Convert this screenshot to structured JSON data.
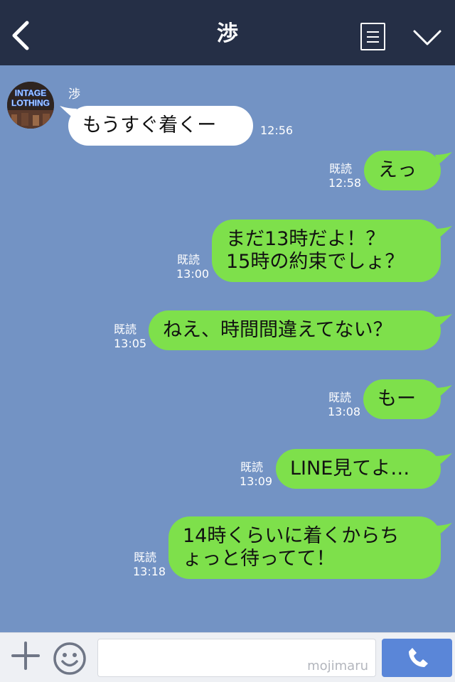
{
  "header": {
    "title": "渉",
    "icons": {
      "back": "chevron-left-icon",
      "menu": "menu-icon",
      "collapse": "chevron-down-icon"
    }
  },
  "chat": {
    "sender_name": "渉",
    "avatar_text": [
      "INTAGE",
      "LOTHING"
    ],
    "messages": [
      {
        "direction": "in",
        "lines": [
          "もうすぐ着くー"
        ],
        "time": "12:56"
      },
      {
        "direction": "out",
        "lines": [
          "えっ"
        ],
        "read": "既読",
        "time": "12:58"
      },
      {
        "direction": "out",
        "lines": [
          "まだ13時だよ！？",
          "15時の約束でしょ？"
        ],
        "read": "既読",
        "time": "13:00"
      },
      {
        "direction": "out",
        "lines": [
          "ねえ、時間間違えてない？"
        ],
        "read": "既読",
        "time": "13:05"
      },
      {
        "direction": "out",
        "lines": [
          "もー"
        ],
        "read": "既読",
        "time": "13:08"
      },
      {
        "direction": "out",
        "lines": [
          "LINE見てよ…"
        ],
        "read": "既読",
        "time": "13:09"
      },
      {
        "direction": "out",
        "lines": [
          "14時くらいに着くからち",
          "ょっと待ってて！"
        ],
        "read": "既読",
        "time": "13:18"
      }
    ]
  },
  "footer": {
    "input_value": "",
    "watermark": "mojimaru",
    "icons": {
      "add": "plus-icon",
      "emoji": "smiley-icon",
      "call": "phone-icon"
    }
  },
  "colors": {
    "header_bg": "#252f46",
    "chat_bg": "#7393c4",
    "incoming_bubble": "#ffffff",
    "outgoing_bubble": "#7ee04b",
    "call_button": "#5a86d8"
  }
}
